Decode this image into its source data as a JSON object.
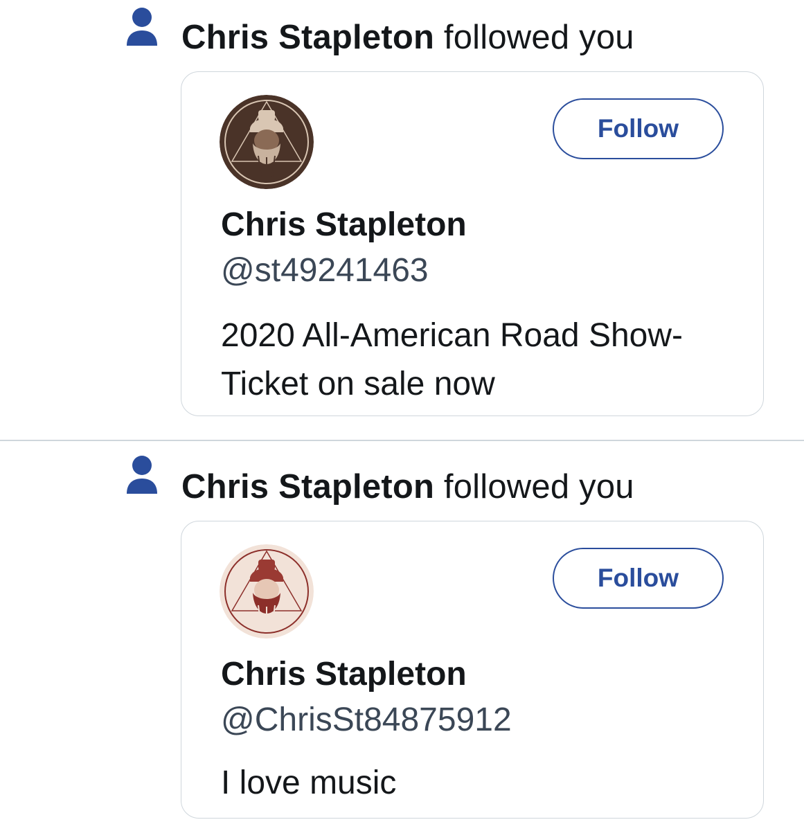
{
  "colors": {
    "accent": "#2a4d9c",
    "text": "#14171a",
    "secondary_text": "#3b4756",
    "border": "#cfd6dc"
  },
  "notifications": [
    {
      "icon": "person-icon",
      "actor": "Chris Stapleton",
      "action": "followed you",
      "card": {
        "avatar": "avatar-dark",
        "display_name": "Chris Stapleton",
        "handle": "@st49241463",
        "bio": "2020 All-American Road Show-Ticket on sale now",
        "follow_label": "Follow"
      }
    },
    {
      "icon": "person-icon",
      "actor": "Chris Stapleton",
      "action": "followed you",
      "card": {
        "avatar": "avatar-light",
        "display_name": "Chris Stapleton",
        "handle": "@ChrisSt84875912",
        "bio": "I love music",
        "follow_label": "Follow"
      }
    }
  ]
}
